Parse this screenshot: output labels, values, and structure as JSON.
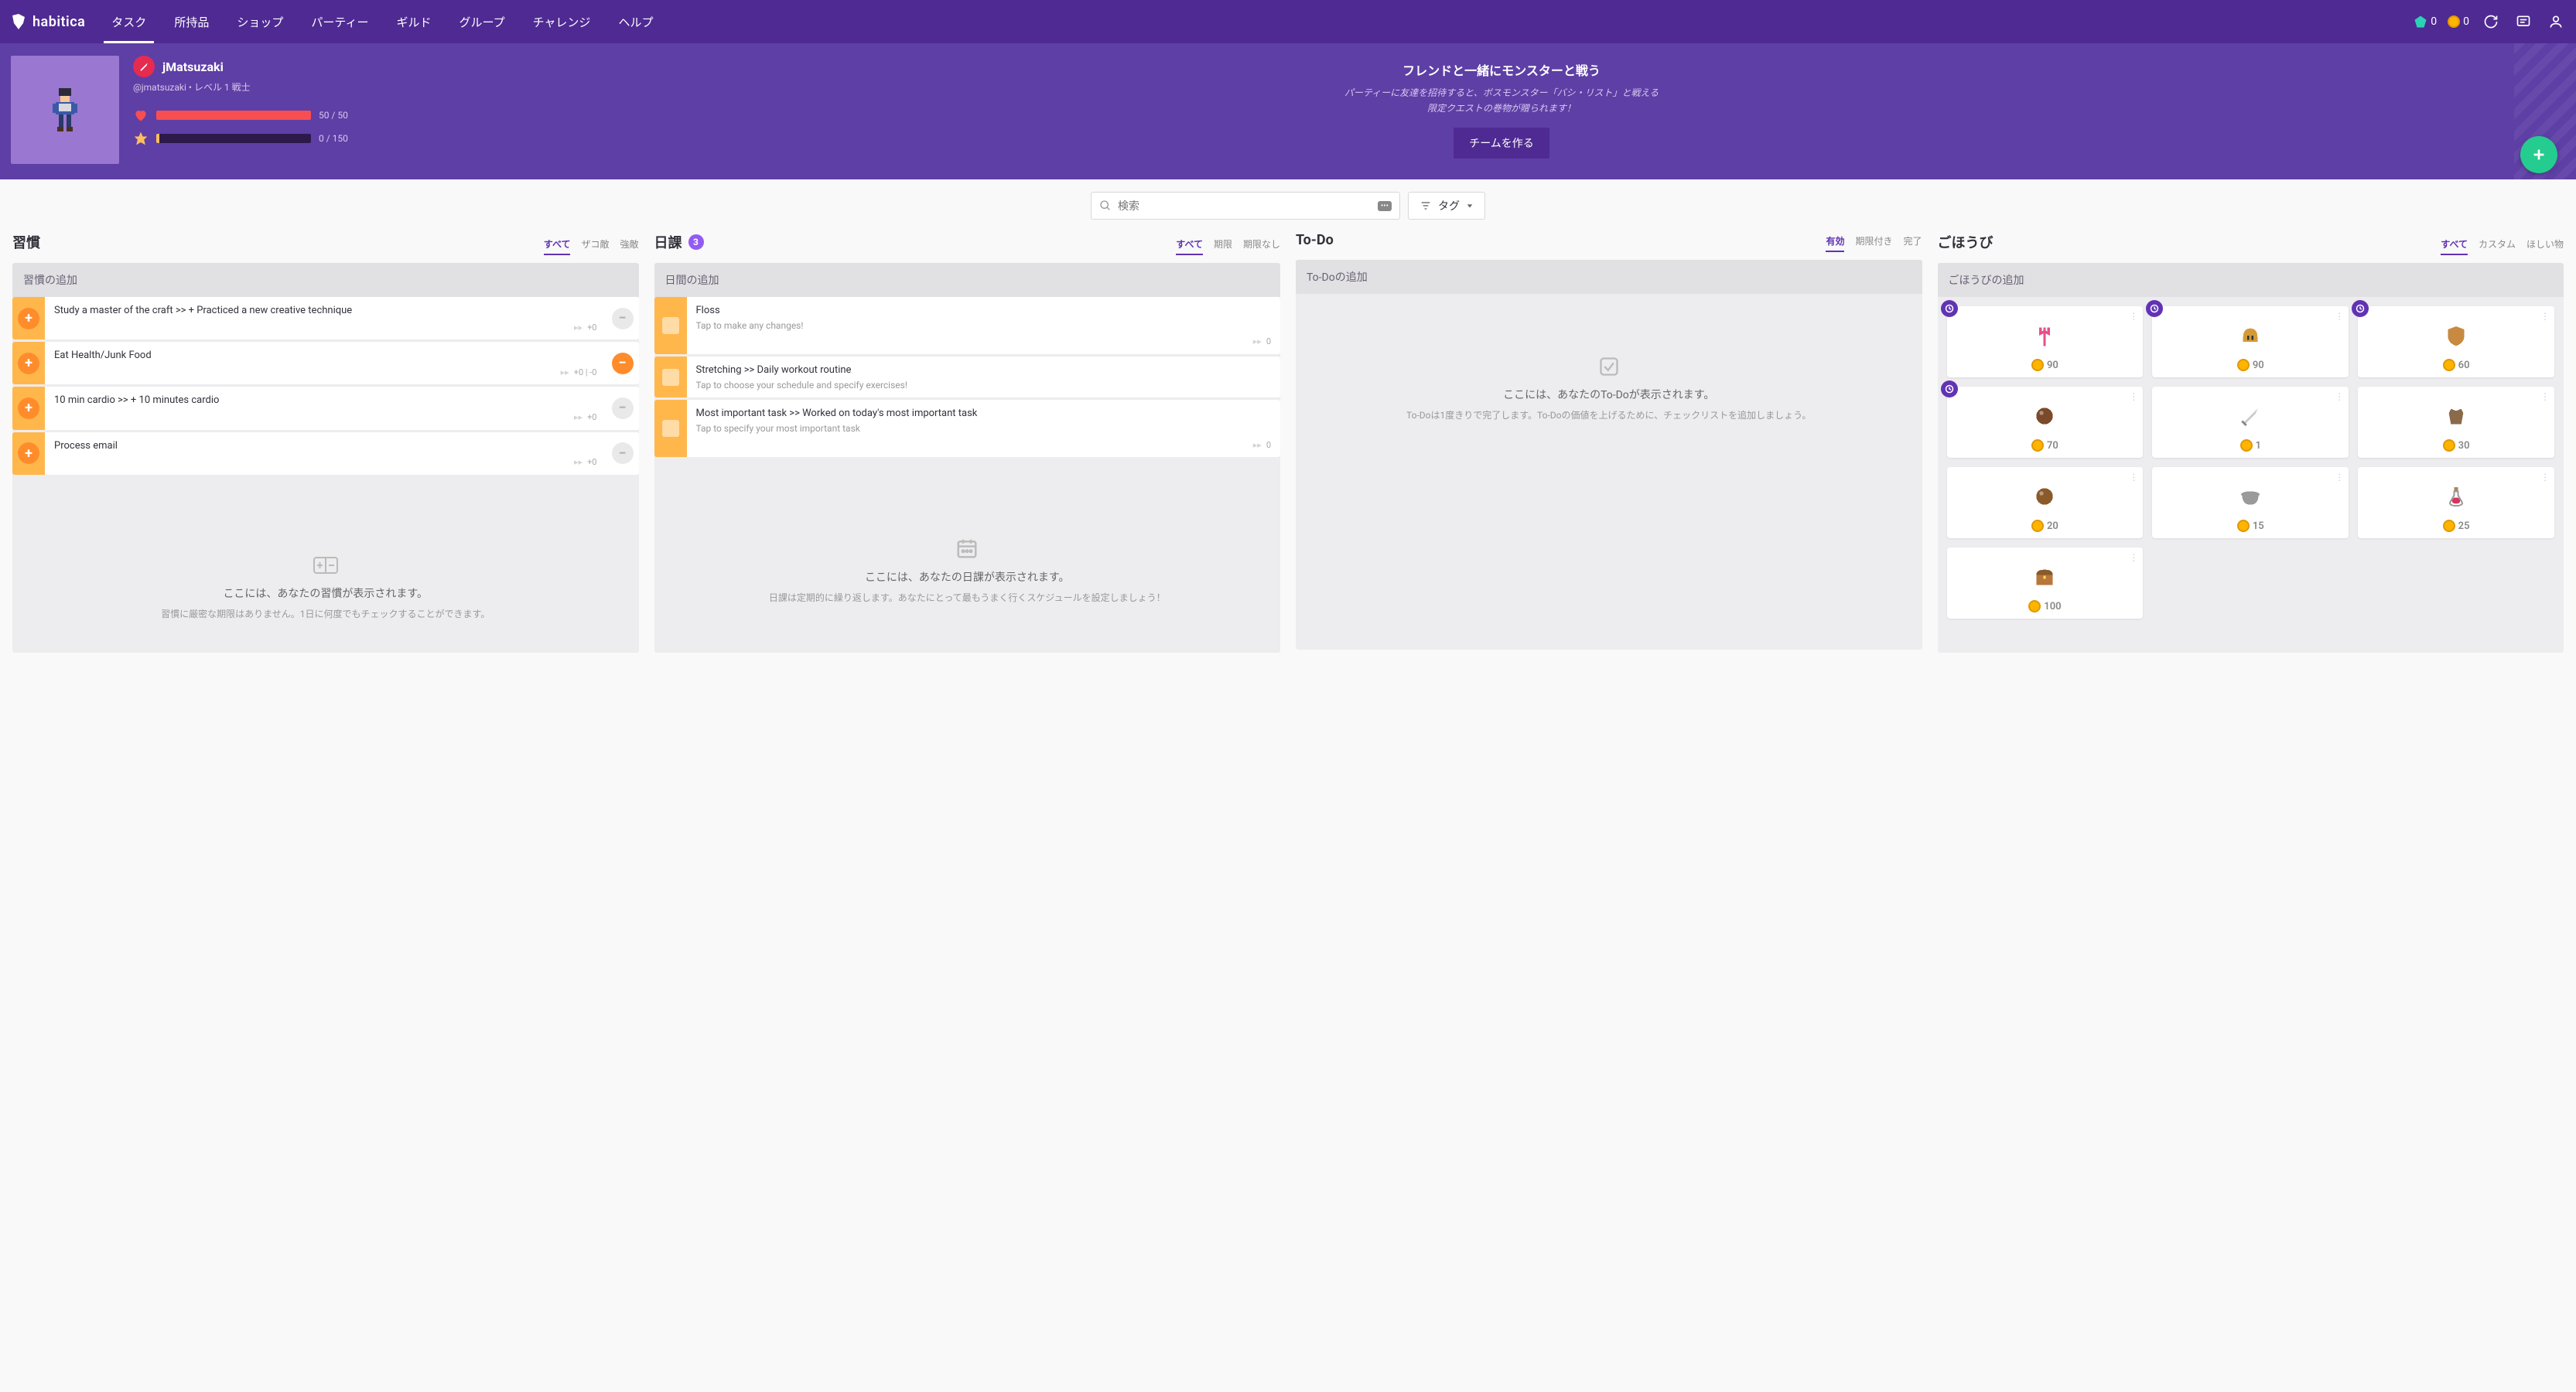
{
  "nav": {
    "brand": "habitica",
    "items": [
      "タスク",
      "所持品",
      "ショップ",
      "パーティー",
      "ギルド",
      "グループ",
      "チャレンジ",
      "ヘルプ"
    ],
    "active_index": 0,
    "gems": "0",
    "gold": "0"
  },
  "user": {
    "name": "jMatsuzaki",
    "handle": "@jmatsuzaki",
    "level_class": "レベル 1 戦士",
    "hp_text": "50 / 50",
    "hp_pct": 100,
    "xp_text": "0 / 150",
    "xp_pct": 2
  },
  "party": {
    "title": "フレンドと一緒にモンスターと戦う",
    "desc1": "パーティーに友達を招待すると、ボスモンスター「バシ・リスト」と戦える",
    "desc2": "限定クエストの巻物が贈られます！",
    "button": "チームを作る"
  },
  "search": {
    "placeholder": "検索",
    "tag_label": "タグ"
  },
  "columns": {
    "habits": {
      "title": "習慣",
      "filters": [
        "すべて",
        "ザコ敵",
        "強敵"
      ],
      "active_filter": 0,
      "add_placeholder": "習慣の追加",
      "items": [
        {
          "title": "Study a master of the craft >> + Practiced a new creative technique",
          "footer": "+0",
          "neg_active": false
        },
        {
          "title": "Eat Health/Junk Food",
          "footer": "+0 | -0",
          "neg_active": true
        },
        {
          "title": "10 min cardio >> + 10 minutes cardio",
          "footer": "+0",
          "neg_active": false
        },
        {
          "title": "Process email",
          "footer": "+0",
          "neg_active": false
        }
      ],
      "empty_title": "ここには、あなたの習慣が表示されます。",
      "empty_desc": "習慣に厳密な期限はありません。1日に何度でもチェックすることができます。"
    },
    "dailies": {
      "title": "日課",
      "badge": "3",
      "filters": [
        "すべて",
        "期限",
        "期限なし"
      ],
      "active_filter": 0,
      "add_placeholder": "日間の追加",
      "items": [
        {
          "title": "Floss",
          "sub": "Tap to make any changes!",
          "streak": "0"
        },
        {
          "title": "Stretching >> Daily workout routine",
          "sub": "Tap to choose your schedule and specify exercises!",
          "streak": ""
        },
        {
          "title": "Most important task >> Worked on today's most important task",
          "sub": "Tap to specify your most important task",
          "streak": "0"
        }
      ],
      "empty_title": "ここには、あなたの日課が表示されます。",
      "empty_desc": "日課は定期的に繰り返します。あなたにとって最もうまく行くスケジュールを設定しましょう！"
    },
    "todos": {
      "title": "To-Do",
      "filters": [
        "有効",
        "期限付き",
        "完了"
      ],
      "active_filter": 0,
      "add_placeholder": "To-Doの追加",
      "empty_title": "ここには、あなたのTo-Doが表示されます。",
      "empty_desc": "To-Doは1度きりで完了します。To-Doの価値を上げるために、チェックリストを追加しましょう。"
    },
    "rewards": {
      "title": "ごほうび",
      "filters": [
        "すべて",
        "カスタム",
        "ほしい物"
      ],
      "active_filter": 0,
      "add_placeholder": "ごほうびの追加",
      "items": [
        {
          "price": "90",
          "clock": true,
          "color": "#e84f8a",
          "icon": "trident"
        },
        {
          "price": "90",
          "clock": true,
          "color": "#d49a3a",
          "icon": "helmet"
        },
        {
          "price": "60",
          "clock": true,
          "color": "#c78a40",
          "icon": "shield"
        },
        {
          "price": "70",
          "clock": true,
          "color": "#7b4a2a",
          "icon": "orb"
        },
        {
          "price": "1",
          "clock": false,
          "color": "#cccccc",
          "icon": "sword"
        },
        {
          "price": "30",
          "clock": false,
          "color": "#8a6a4a",
          "icon": "armor"
        },
        {
          "price": "20",
          "clock": false,
          "color": "#8b5a2b",
          "icon": "orb"
        },
        {
          "price": "15",
          "clock": false,
          "color": "#9a9a9a",
          "icon": "pot"
        },
        {
          "price": "25",
          "clock": false,
          "color": "#d8345f",
          "icon": "potion"
        },
        {
          "price": "100",
          "clock": false,
          "color": "#b8763a",
          "icon": "chest"
        }
      ]
    }
  }
}
